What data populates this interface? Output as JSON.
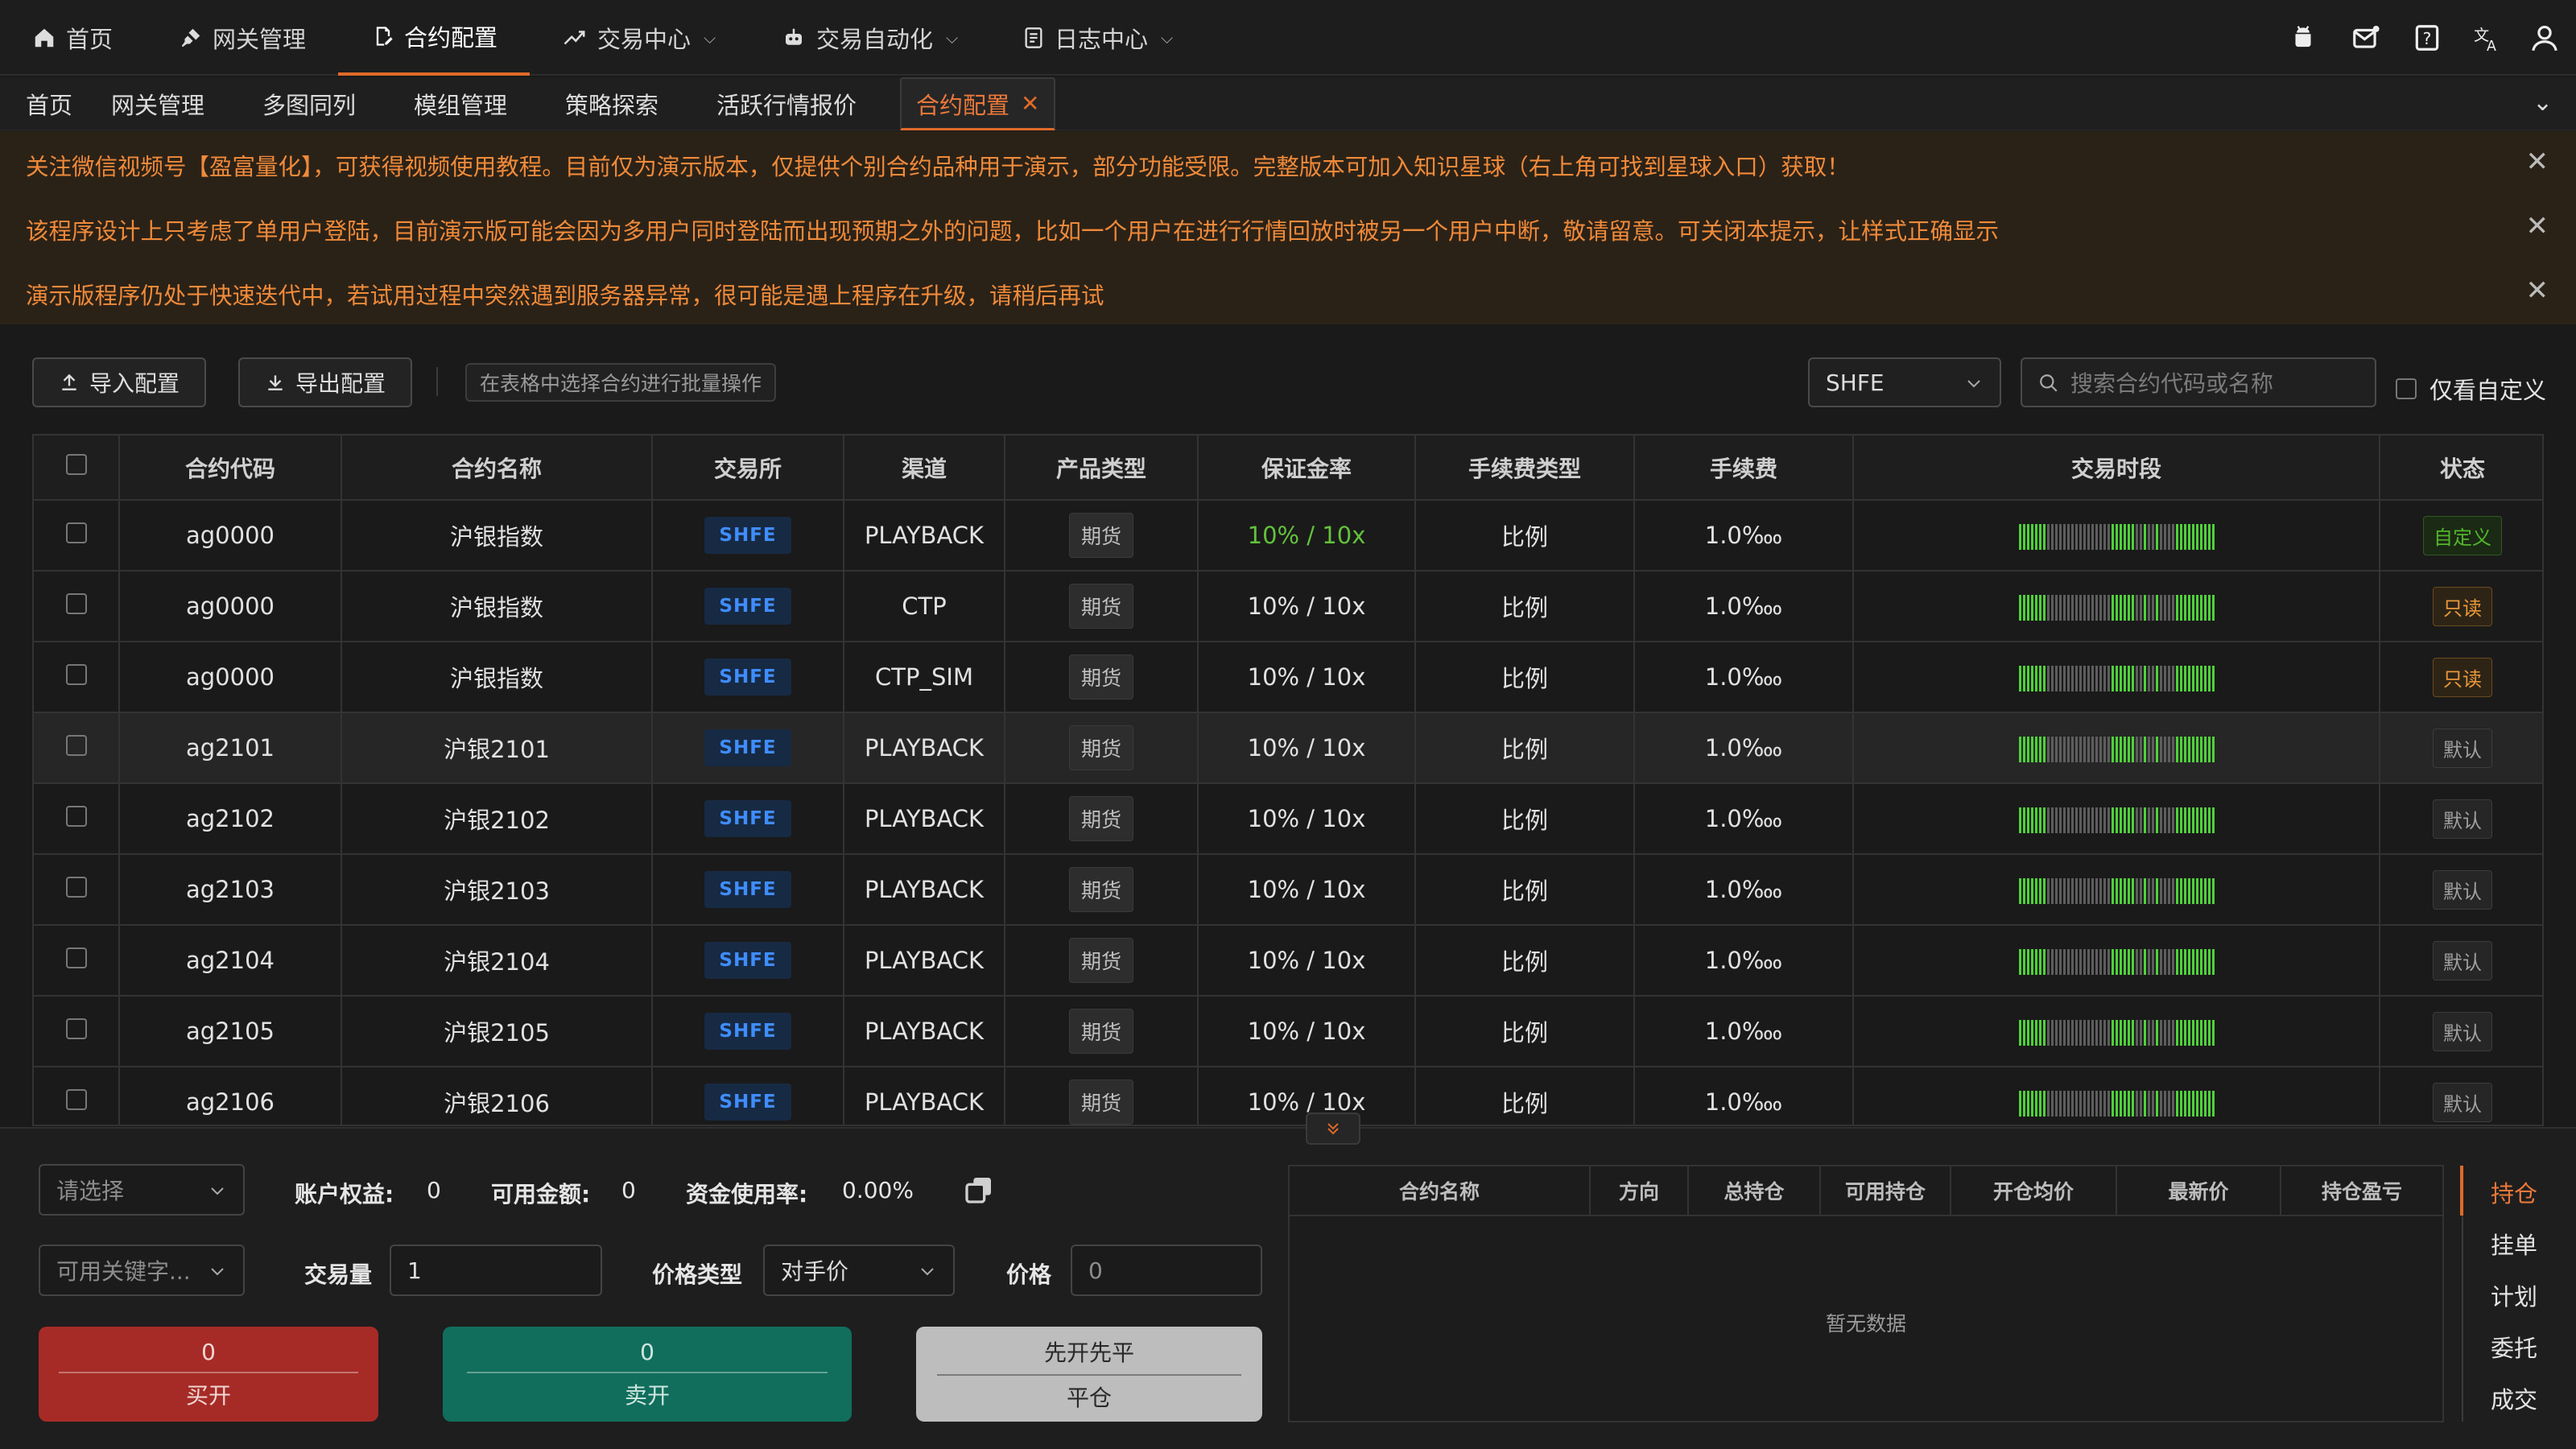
{
  "topnav": {
    "items": [
      {
        "label": "首页",
        "icon": "home-icon"
      },
      {
        "label": "网关管理",
        "icon": "plug-icon"
      },
      {
        "label": "合约配置",
        "icon": "file-edit-icon"
      },
      {
        "label": "交易中心",
        "icon": "trend-icon"
      },
      {
        "label": "交易自动化",
        "icon": "robot-icon"
      },
      {
        "label": "日志中心",
        "icon": "log-icon"
      }
    ],
    "right_icons": [
      "android-icon",
      "mail-icon",
      "help-icon",
      "translate-icon",
      "user-icon"
    ]
  },
  "tabs": {
    "items": [
      "首页",
      "网关管理",
      "多图同列",
      "模组管理",
      "策略探索",
      "活跃行情报价",
      "合约配置"
    ],
    "active": "合约配置"
  },
  "notices": [
    "关注微信视频号【盈富量化】，可获得视频使用教程。目前仅为演示版本，仅提供个别合约品种用于演示，部分功能受限。完整版本可加入知识星球（右上角可找到星球入口）获取！",
    "该程序设计上只考虑了单用户登陆，目前演示版可能会因为多用户同时登陆而出现预期之外的问题，比如一个用户在进行行情回放时被另一个用户中断，敬请留意。可关闭本提示，让样式正确显示",
    "演示版程序仍处于快速迭代中，若试用过程中突然遇到服务器异常，很可能是遇上程序在升级，请稍后再试"
  ],
  "toolbar": {
    "import_label": "导入配置",
    "export_label": "导出配置",
    "batch_hint": "在表格中选择合约进行批量操作",
    "exchange_value": "SHFE",
    "search_placeholder": "搜索合约代码或名称",
    "custom_only_label": "仅看自定义"
  },
  "table": {
    "headers": [
      "合约代码",
      "合约名称",
      "交易所",
      "渠道",
      "产品类型",
      "保证金率",
      "手续费类型",
      "手续费",
      "交易时段",
      "状态"
    ],
    "rows": [
      {
        "code": "ag0000",
        "name": "沪银指数",
        "exchange": "SHFE",
        "channel": "PLAYBACK",
        "ptype": "期货",
        "margin": "10% / 10x",
        "fee_type": "比例",
        "fee": "1.0‱",
        "status": "自定义",
        "status_kind": "custom",
        "margin_green": true
      },
      {
        "code": "ag0000",
        "name": "沪银指数",
        "exchange": "SHFE",
        "channel": "CTP",
        "ptype": "期货",
        "margin": "10% / 10x",
        "fee_type": "比例",
        "fee": "1.0‱",
        "status": "只读",
        "status_kind": "ro"
      },
      {
        "code": "ag0000",
        "name": "沪银指数",
        "exchange": "SHFE",
        "channel": "CTP_SIM",
        "ptype": "期货",
        "margin": "10% / 10x",
        "fee_type": "比例",
        "fee": "1.0‱",
        "status": "只读",
        "status_kind": "ro"
      },
      {
        "code": "ag2101",
        "name": "沪银2101",
        "exchange": "SHFE",
        "channel": "PLAYBACK",
        "ptype": "期货",
        "margin": "10% / 10x",
        "fee_type": "比例",
        "fee": "1.0‱",
        "status": "默认",
        "status_kind": "def",
        "highlight": true
      },
      {
        "code": "ag2102",
        "name": "沪银2102",
        "exchange": "SHFE",
        "channel": "PLAYBACK",
        "ptype": "期货",
        "margin": "10% / 10x",
        "fee_type": "比例",
        "fee": "1.0‱",
        "status": "默认",
        "status_kind": "def"
      },
      {
        "code": "ag2103",
        "name": "沪银2103",
        "exchange": "SHFE",
        "channel": "PLAYBACK",
        "ptype": "期货",
        "margin": "10% / 10x",
        "fee_type": "比例",
        "fee": "1.0‱",
        "status": "默认",
        "status_kind": "def"
      },
      {
        "code": "ag2104",
        "name": "沪银2104",
        "exchange": "SHFE",
        "channel": "PLAYBACK",
        "ptype": "期货",
        "margin": "10% / 10x",
        "fee_type": "比例",
        "fee": "1.0‱",
        "status": "默认",
        "status_kind": "def"
      },
      {
        "code": "ag2105",
        "name": "沪银2105",
        "exchange": "SHFE",
        "channel": "PLAYBACK",
        "ptype": "期货",
        "margin": "10% / 10x",
        "fee_type": "比例",
        "fee": "1.0‱",
        "status": "默认",
        "status_kind": "def"
      },
      {
        "code": "ag2106",
        "name": "沪银2106",
        "exchange": "SHFE",
        "channel": "PLAYBACK",
        "ptype": "期货",
        "margin": "10% / 10x",
        "fee_type": "比例",
        "fee": "1.0‱",
        "status": "默认",
        "status_kind": "def"
      }
    ],
    "session_pattern": "1111111000000000000000011111100100100001111111111"
  },
  "trade_panel": {
    "account_placeholder": "请选择",
    "equity_label": "账户权益:",
    "equity_value": "0",
    "available_label": "可用金额:",
    "available_value": "0",
    "usage_label": "资金使用率:",
    "usage_value": "0.00%",
    "keyword_placeholder": "可用关键字...",
    "volume_label": "交易量",
    "volume_value": "1",
    "price_type_label": "价格类型",
    "price_type_value": "对手价",
    "price_label": "价格",
    "price_value": "0",
    "buy_count": "0",
    "buy_label": "买开",
    "sell_count": "0",
    "sell_label": "卖开",
    "close_top": "先开先平",
    "close_label": "平仓"
  },
  "positions": {
    "headers": [
      "合约名称",
      "方向",
      "总持仓",
      "可用持仓",
      "开仓均价",
      "最新价",
      "持仓盈亏"
    ],
    "empty_text": "暂无数据",
    "side_tabs": [
      "持仓",
      "挂单",
      "计划",
      "委托",
      "成交"
    ],
    "active_side_tab": "持仓"
  },
  "colors": {
    "accent": "#e06a2a",
    "buy": "#a62b26",
    "sell": "#116e5c",
    "close": "#bdbdbd",
    "exchange": "#3f8dff",
    "session_on": "#4fd13a"
  }
}
